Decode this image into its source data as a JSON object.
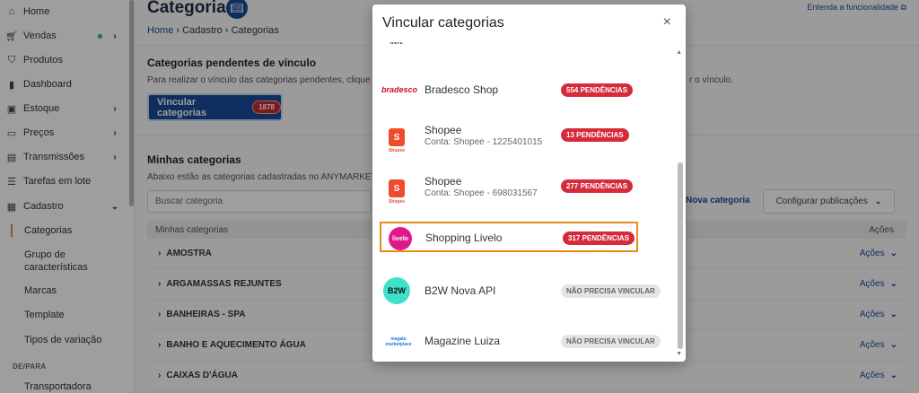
{
  "sidebar": {
    "items": [
      {
        "label": "Home",
        "icon": "home-icon"
      },
      {
        "label": "Vendas",
        "icon": "cart-icon"
      },
      {
        "label": "Produtos",
        "icon": "shirt-icon"
      },
      {
        "label": "Dashboard",
        "icon": "bar-chart-icon"
      },
      {
        "label": "Estoque",
        "icon": "box-icon"
      },
      {
        "label": "Preços",
        "icon": "money-icon"
      },
      {
        "label": "Transmissões",
        "icon": "calendar-icon"
      },
      {
        "label": "Tarefas em lote",
        "icon": "list-icon"
      },
      {
        "label": "Cadastro",
        "icon": "clipboard-icon"
      }
    ],
    "subitems": [
      "Categorias",
      "Grupo de características",
      "Marcas",
      "Template",
      "Tipos de variação"
    ],
    "section_label": "DE/PARA",
    "section_items": [
      "Transportadora"
    ]
  },
  "header": {
    "title": "Categorias",
    "breadcrumb": [
      "Home",
      "Cadastro",
      "Categorias"
    ],
    "help_link": "Entenda a funcionalidade"
  },
  "pending": {
    "title": "Categorias pendentes de vínculo",
    "desc_left": "Para realizar o vínculo das categorias pendentes, clique",
    "desc_right": "r o vínculo.",
    "button_label": "Vincular categorias",
    "button_count": "1878"
  },
  "mine": {
    "title": "Minhas categorias",
    "desc": "Abaixo estão as categorias cadastradas no ANYMARKET.",
    "search_placeholder": "Buscar categoria",
    "new_label": "Nova categoria",
    "config_label": "Configurar publicações",
    "col_name": "Minhas categorias",
    "col_actions": "Ações",
    "actions_label": "Ações",
    "rows": [
      "AMOSTRA",
      "ARGAMASSAS REJUNTES",
      "BANHEIRAS - SPA",
      "BANHO E AQUECIMENTO ÁGUA",
      "CAIXAS D'ÁGUA"
    ]
  },
  "modal": {
    "title": "Vincular categorias",
    "close": "×",
    "items": [
      {
        "name": "",
        "sub": "",
        "logo_text": "livre",
        "badge": ""
      },
      {
        "name": "Bradesco Shop",
        "sub": "",
        "logo_text": "bradesco",
        "badge": "554 PENDÊNCIAS",
        "badge_type": "red"
      },
      {
        "name": "Shopee",
        "sub": "Conta: Shopee - 1225401015",
        "logo_text": "S",
        "logo_caption": "Shopee",
        "badge": "13 PENDÊNCIAS",
        "badge_type": "red"
      },
      {
        "name": "Shopee",
        "sub": "Conta: Shopee - 698031567",
        "logo_text": "S",
        "logo_caption": "Shopee",
        "badge": "277 PENDÊNCIAS",
        "badge_type": "red"
      },
      {
        "name": "Shopping Livelo",
        "sub": "",
        "logo_text": "livelo",
        "badge": "317 PENDÊNCIAS",
        "badge_type": "red",
        "highlighted": true
      },
      {
        "name": "B2W Nova API",
        "sub": "",
        "logo_text": "B2W",
        "badge": "NÃO PRECISA VINCULAR",
        "badge_type": "grey"
      },
      {
        "name": "Magazine Luiza",
        "sub": "",
        "logo_text": "magalu marketplace",
        "badge": "NÃO PRECISA VINCULAR",
        "badge_type": "grey"
      }
    ]
  },
  "colors": {
    "primary": "#1a4a9c",
    "danger": "#d62b3a",
    "highlight": "#e98a1c",
    "shopee": "#ee4d2d",
    "livelo": "#e0198a",
    "b2w": "#3ee0c8"
  }
}
